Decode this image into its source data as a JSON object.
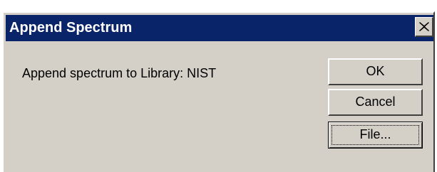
{
  "dialog": {
    "title": "Append Spectrum",
    "message": "Append spectrum to Library: NIST",
    "buttons": {
      "ok": "OK",
      "cancel": "Cancel",
      "file": "File..."
    },
    "close_icon": "close-icon"
  },
  "colors": {
    "titlebar": "#0a246a",
    "face": "#d4d0c8"
  }
}
